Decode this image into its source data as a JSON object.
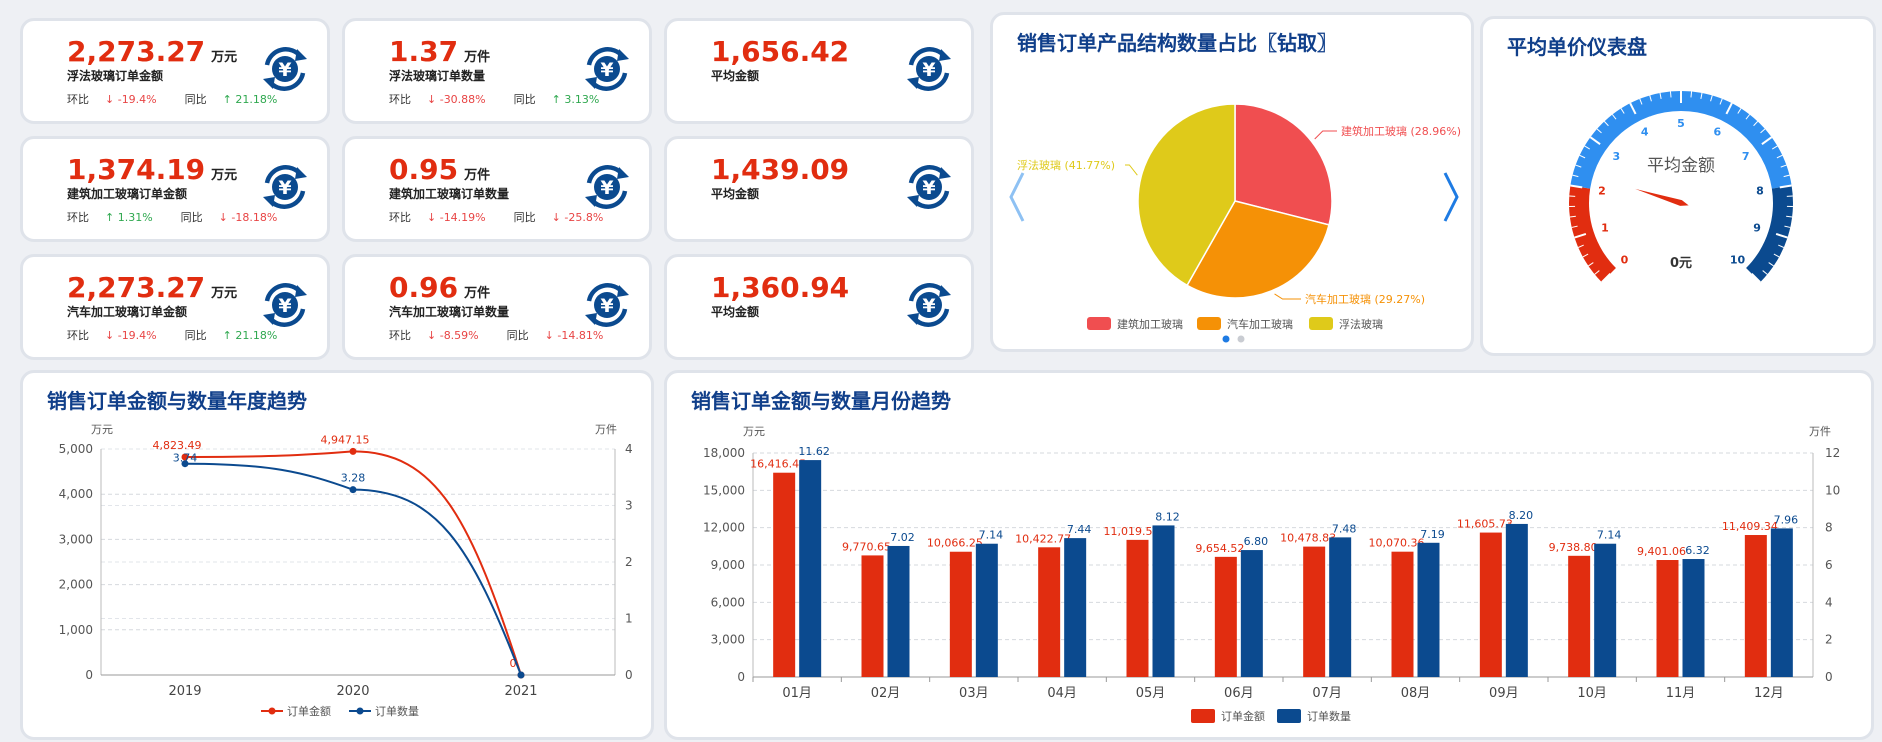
{
  "kpis": [
    {
      "value": "2,273.27",
      "unit": "万元",
      "label": "浮法玻璃订单金额",
      "mom_label": "环比",
      "mom_dir": "down",
      "mom": "-19.4%",
      "yoy_label": "同比",
      "yoy_dir": "up",
      "yoy": "21.18%"
    },
    {
      "value": "1.37",
      "unit": "万件",
      "label": "浮法玻璃订单数量",
      "mom_label": "环比",
      "mom_dir": "down",
      "mom": "-30.88%",
      "yoy_label": "同比",
      "yoy_dir": "up",
      "yoy": "3.13%"
    },
    {
      "value": "1,656.42",
      "unit": "",
      "label": "平均金额"
    },
    {
      "value": "1,374.19",
      "unit": "万元",
      "label": "建筑加工玻璃订单金额",
      "mom_label": "环比",
      "mom_dir": "up",
      "mom": "1.31%",
      "yoy_label": "同比",
      "yoy_dir": "down",
      "yoy": "-18.18%"
    },
    {
      "value": "0.95",
      "unit": "万件",
      "label": "建筑加工玻璃订单数量",
      "mom_label": "环比",
      "mom_dir": "down",
      "mom": "-14.19%",
      "yoy_label": "同比",
      "yoy_dir": "down",
      "yoy": "-25.8%"
    },
    {
      "value": "1,439.09",
      "unit": "",
      "label": "平均金额"
    },
    {
      "value": "2,273.27",
      "unit": "万元",
      "label": "汽车加工玻璃订单金额",
      "mom_label": "环比",
      "mom_dir": "down",
      "mom": "-19.4%",
      "yoy_label": "同比",
      "yoy_dir": "up",
      "yoy": "21.18%"
    },
    {
      "value": "0.96",
      "unit": "万件",
      "label": "汽车加工玻璃订单数量",
      "mom_label": "环比",
      "mom_dir": "down",
      "mom": "-8.59%",
      "yoy_label": "同比",
      "yoy_dir": "down",
      "yoy": "-14.81%"
    },
    {
      "value": "1,360.94",
      "unit": "",
      "label": "平均金额"
    }
  ],
  "icons": {
    "kpi": "yuan-cycle-icon",
    "prev": "chevron-left-icon",
    "next": "chevron-right-icon"
  },
  "colors": {
    "accent": "#103f8a",
    "red": "#e12d10",
    "blue": "#0b4a8f",
    "pie_red": "#f04e50",
    "pie_orange": "#f59106",
    "pie_yellow": "#dfca1a"
  },
  "pie_panel": {
    "title": "销售订单产品结构数量占比〖钻取〗",
    "chart_data": {
      "type": "pie",
      "slices": [
        {
          "name": "建筑加工玻璃",
          "value": 28.96,
          "label": "建筑加工玻璃 (28.96%)"
        },
        {
          "name": "汽车加工玻璃",
          "value": 29.27,
          "label": "汽车加工玻璃 (29.27%)"
        },
        {
          "name": "浮法玻璃",
          "value": 41.77,
          "label": "浮法玻璃 (41.77%)"
        }
      ],
      "legend": [
        "建筑加工玻璃",
        "汽车加工玻璃",
        "浮法玻璃"
      ],
      "legend_position": "bottom"
    }
  },
  "gauge_panel": {
    "title": "平均单价仪表盘",
    "chart_data": {
      "type": "gauge",
      "min": 0,
      "max": 10,
      "value": 0,
      "ticks": [
        "0",
        "1",
        "2",
        "3",
        "4",
        "5",
        "6",
        "7",
        "8",
        "9",
        "10"
      ],
      "label": "平均金额",
      "value_text": "0元"
    }
  },
  "year_panel": {
    "title": "销售订单金额与数量年度趋势",
    "chart_data": {
      "type": "line",
      "categories": [
        "2019",
        "2020",
        "2021"
      ],
      "series": [
        {
          "name": "订单金额",
          "axis": "left",
          "values": [
            4823.49,
            4947.15,
            0
          ],
          "labels": [
            "4,823.49",
            "4,947.15",
            "0"
          ]
        },
        {
          "name": "订单数量",
          "axis": "right",
          "values": [
            3.74,
            3.28,
            0
          ],
          "labels": [
            "3.74",
            "3.28",
            ""
          ]
        }
      ],
      "y_left": {
        "unit": "万元",
        "min": 0,
        "max": 5000,
        "ticks": [
          "0",
          "1,000",
          "2,000",
          "3,000",
          "4,000",
          "5,000"
        ]
      },
      "y_right": {
        "unit": "万件",
        "min": 0,
        "max": 4,
        "ticks": [
          "0",
          "1",
          "2",
          "3",
          "4"
        ]
      },
      "grid": true,
      "legend_position": "bottom"
    }
  },
  "month_panel": {
    "title": "销售订单金额与数量月份趋势",
    "chart_data": {
      "type": "bar",
      "categories": [
        "01月",
        "02月",
        "03月",
        "04月",
        "05月",
        "06月",
        "07月",
        "08月",
        "09月",
        "10月",
        "11月",
        "12月"
      ],
      "series": [
        {
          "name": "订单金额",
          "axis": "left",
          "values": [
            16416.45,
            9770.65,
            10066.25,
            10422.77,
            11019.59,
            9654.52,
            10478.83,
            10070.36,
            11605.73,
            9738.8,
            9401.06,
            11409.34
          ],
          "labels": [
            "16,416.45",
            "9,770.65",
            "10,066.25",
            "10,422.77",
            "11,019.59",
            "9,654.52",
            "10,478.83",
            "10,070.36",
            "11,605.73",
            "9,738.80",
            "9,401.06",
            "11,409.34"
          ]
        },
        {
          "name": "订单数量",
          "axis": "right",
          "values": [
            11.62,
            7.02,
            7.14,
            7.44,
            8.12,
            6.8,
            7.48,
            7.19,
            8.2,
            7.14,
            6.32,
            7.96
          ],
          "labels": [
            "11.62",
            "7.02",
            "7.14",
            "7.44",
            "8.12",
            "6.80",
            "7.48",
            "7.19",
            "8.20",
            "7.14",
            "6.32",
            "7.96"
          ]
        }
      ],
      "y_left": {
        "unit": "万元",
        "min": 0,
        "max": 18000,
        "ticks": [
          "0",
          "3,000",
          "6,000",
          "9,000",
          "12,000",
          "15,000",
          "18,000"
        ]
      },
      "y_right": {
        "unit": "万件",
        "min": 0,
        "max": 12,
        "ticks": [
          "0",
          "2",
          "4",
          "6",
          "8",
          "10",
          "12"
        ]
      },
      "grid": true,
      "legend_position": "bottom"
    }
  }
}
